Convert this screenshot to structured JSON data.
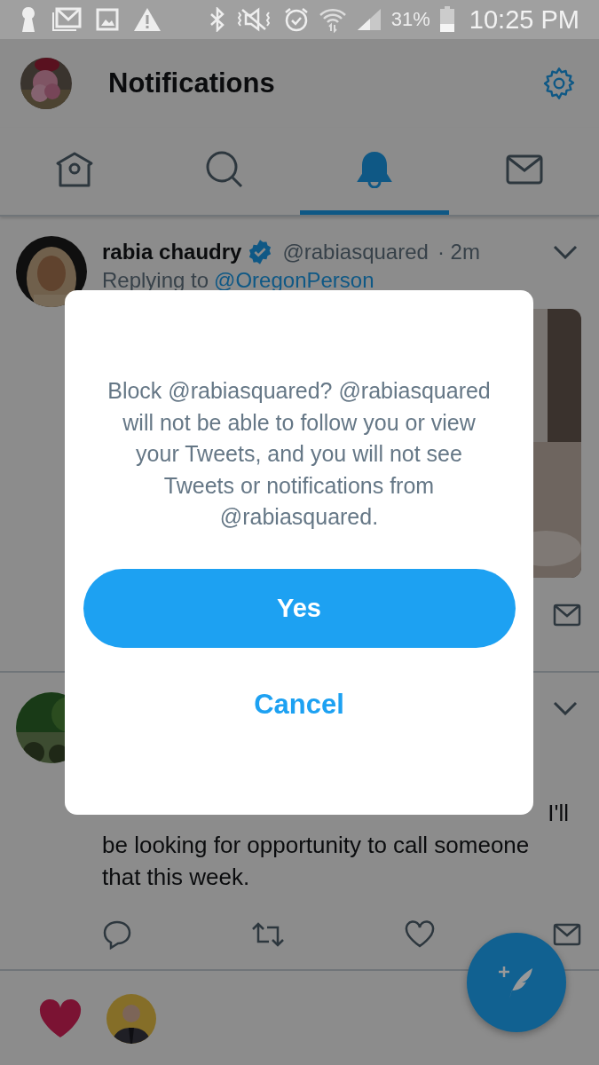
{
  "status_bar": {
    "battery": "31%",
    "time": "10:25 PM"
  },
  "header": {
    "title": "Notifications"
  },
  "tabs": [
    {
      "kind": "home",
      "selected": false
    },
    {
      "kind": "search",
      "selected": false
    },
    {
      "kind": "notifications",
      "selected": true
    },
    {
      "kind": "messages",
      "selected": false
    }
  ],
  "tweets": [
    {
      "name": "rabia chaudry",
      "verified": true,
      "handle": "@rabiasquared",
      "time": "· 2m",
      "replying_label": "Replying to",
      "replying_to": "@OregonPerson"
    },
    {
      "text_tail": "I'll",
      "text": "be looking for opportunity to call someone that this week."
    }
  ],
  "dialog": {
    "message": "Block @rabiasquared? @rabiasquared will not be able to follow you or view your Tweets, and you will not see Tweets or notifications from @rabiasquared.",
    "buttons": [
      {
        "label": "Yes",
        "kind": "primary"
      },
      {
        "label": "Cancel",
        "kind": "text"
      }
    ]
  }
}
